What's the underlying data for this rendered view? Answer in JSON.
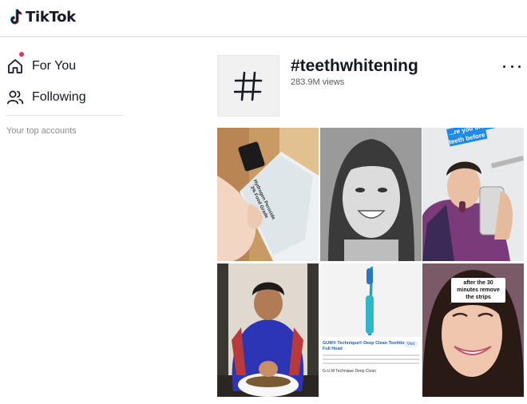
{
  "header": {
    "logo_text": "TikTok"
  },
  "sidebar": {
    "for_you_label": "For You",
    "following_label": "Following",
    "top_accounts_label": "Your top accounts"
  },
  "tag": {
    "title": "#teethwhitening",
    "views": "283.9M views"
  },
  "videos": [
    {
      "id": 1,
      "caption": "",
      "overlay": "Hydrogen Peroxide 3% Food Grade"
    },
    {
      "id": 2,
      "caption": ""
    },
    {
      "id": 3,
      "caption": "...re you brush your teeth before"
    },
    {
      "id": 4,
      "caption": ""
    },
    {
      "id": 5,
      "caption": "",
      "product_name": "GUM® Technique® Deep Clean Toothbrush Full Head",
      "product_visit": "Visit",
      "product_footer": "G-U-M Technique Deep Clean"
    },
    {
      "id": 6,
      "caption": "after the 30 minutes remove the strips"
    }
  ],
  "colors": {
    "brand_red": "#fe2c55",
    "brand_cyan": "#25f4ee",
    "text_primary": "#161823",
    "text_secondary": "#8a8b91",
    "caption_blue": "#1e88e5"
  },
  "icons": {
    "home": "home-icon",
    "following": "people-icon",
    "hashtag": "hashtag-icon",
    "more": "more-dots-icon"
  }
}
